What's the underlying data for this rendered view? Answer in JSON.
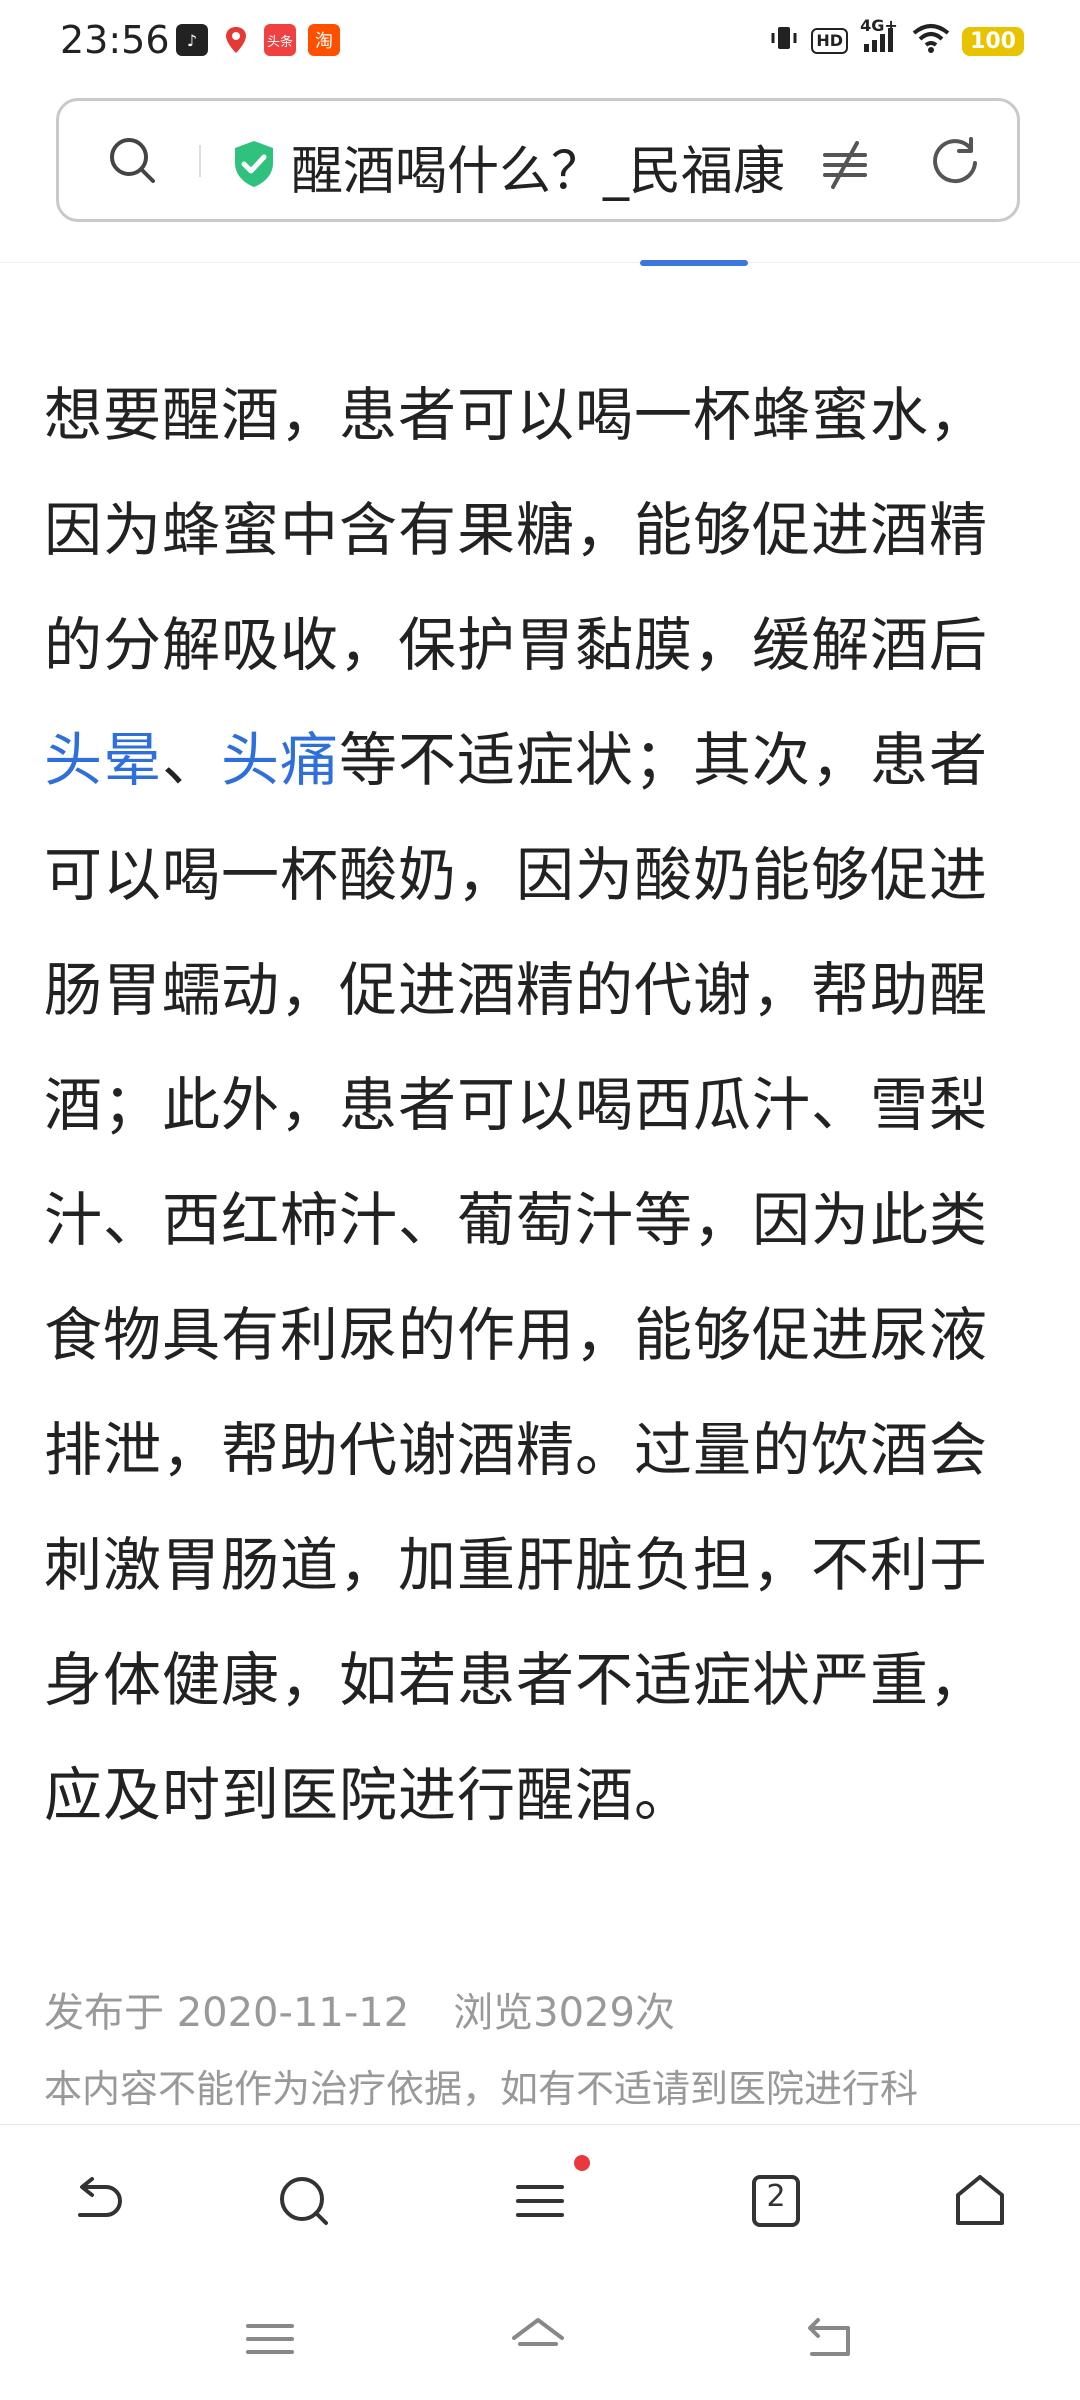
{
  "status_bar": {
    "time": "23:56",
    "notification_icons": [
      "tiktok-icon",
      "map-pin-icon",
      "toutiao-icon",
      "taobao-icon"
    ],
    "toutiao_label": "头条",
    "taobao_label": "淘",
    "hd_label": "HD",
    "network_label": "4G+",
    "battery": "100"
  },
  "address_bar": {
    "title": "醒酒喝什么？_民福康"
  },
  "article": {
    "part1": "想要醒酒，患者可以喝一杯蜂蜜水，因为蜂蜜中含有果糖，能够促进酒精的分解吸收，保护胃黏膜，缓解酒后",
    "link1": "头晕",
    "sep": "、",
    "link2": "头痛",
    "part2": "等不适症状；其次，患者可以喝一杯酸奶，因为酸奶能够促进肠胃蠕动，促进酒精的代谢，帮助醒酒；此外，患者可以喝西瓜汁、雪梨汁、西红柿汁、葡萄汁等，因为此类食物具有利尿的作用，能够促进尿液排泄，帮助代谢酒精。过量的饮酒会刺激胃肠道，加重肝脏负担，不利于身体健康，如若患者不适症状严重，应及时到医院进行醒酒。"
  },
  "meta": {
    "published": "发布于 2020-11-12",
    "views": "浏览3029次"
  },
  "disclaimer": "本内容不能作为治疗依据，如有不适请到医院进行科",
  "bottom_nav": {
    "tab_count": "2",
    "menu_has_notification": true
  },
  "colors": {
    "link": "#2e6fdc",
    "shield": "#2ec27e",
    "battery": "#e8c400",
    "notification_dot": "#e8393e"
  }
}
